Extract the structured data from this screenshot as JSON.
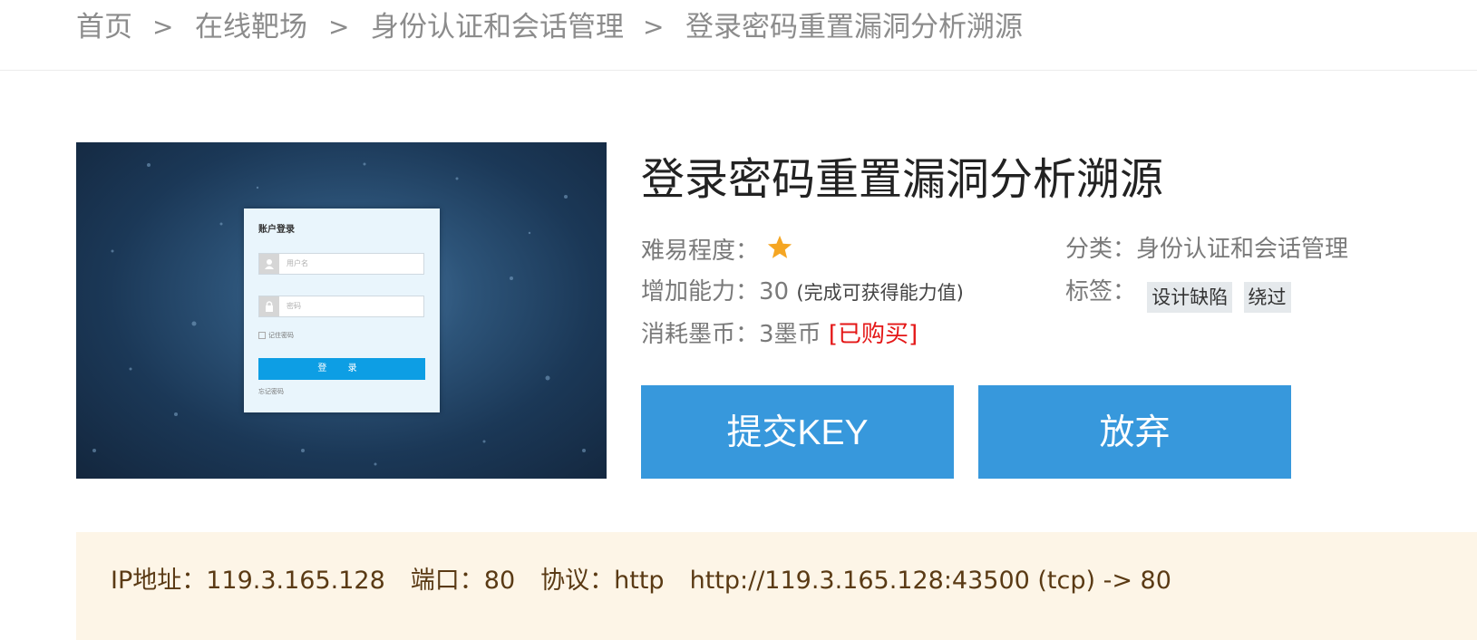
{
  "breadcrumb": {
    "items": [
      "首页",
      "在线靶场",
      "身份认证和会话管理",
      "登录密码重置漏洞分析溯源"
    ],
    "separator": ">"
  },
  "thumbnail": {
    "card_title": "账户登录",
    "username_placeholder": "用户名",
    "password_placeholder": "密码",
    "remember_label": "记住密码",
    "login_button": "登 录",
    "forgot_link": "忘记密码"
  },
  "challenge": {
    "title": "登录密码重置漏洞分析溯源",
    "difficulty_label": "难易程度：",
    "difficulty_stars": 1,
    "ability_label": "增加能力：",
    "ability_value": "30",
    "ability_note": "(完成可获得能力值)",
    "cost_label": "消耗墨币：",
    "cost_value": "3墨币",
    "purchase_status": "[已购买]",
    "category_label": "分类：",
    "category_value": "身份认证和会话管理",
    "tags_label": "标签：",
    "tags": [
      "设计缺陷",
      "绕过"
    ]
  },
  "actions": {
    "submit_label": "提交KEY",
    "abandon_label": "放弃"
  },
  "connection": {
    "ip": "IP地址：119.3.165.128",
    "port": "端口：80",
    "protocol": "协议：http",
    "mapping": "http://119.3.165.128:43500 (tcp) -> 80"
  },
  "colors": {
    "accent_button": "#3798dc",
    "purchase_red": "#e41616",
    "star": "#f5a623",
    "info_bg": "#fdf5e7"
  }
}
